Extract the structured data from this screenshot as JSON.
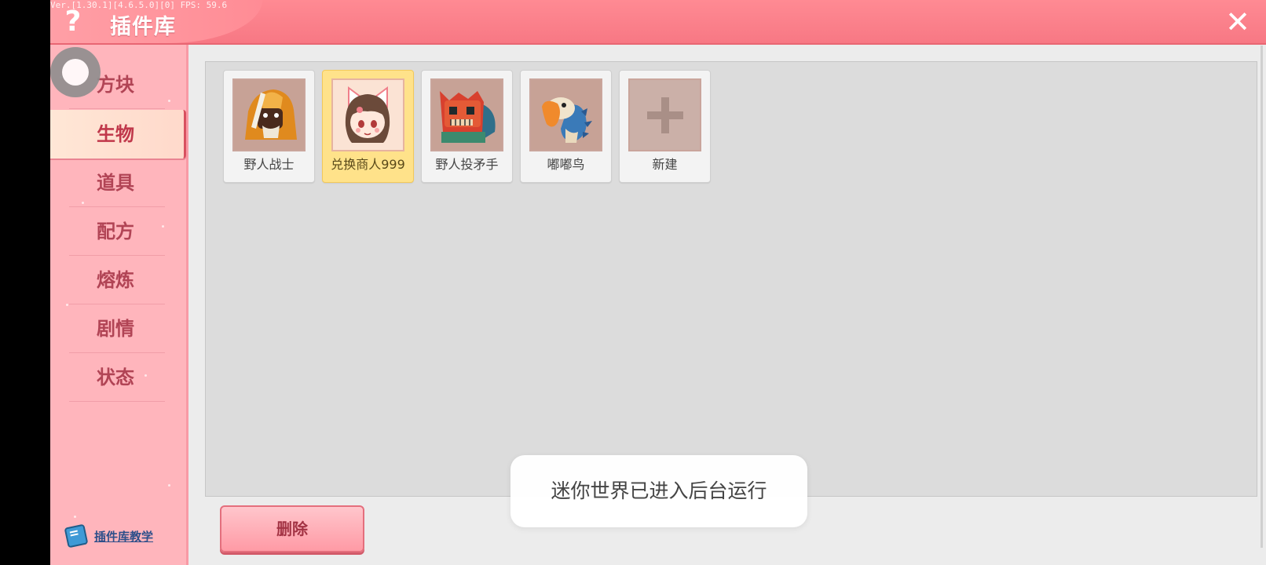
{
  "debug_text": "Ver.[1.30.1][4.6.5.0][0] FPS: 59.6",
  "titlebar": {
    "help_glyph": "?",
    "title": "插件库",
    "close_glyph": "✕"
  },
  "sidebar": {
    "items": [
      {
        "label": "方块",
        "active": false
      },
      {
        "label": "生物",
        "active": true
      },
      {
        "label": "道具",
        "active": false
      },
      {
        "label": "配方",
        "active": false
      },
      {
        "label": "熔炼",
        "active": false
      },
      {
        "label": "剧情",
        "active": false
      },
      {
        "label": "状态",
        "active": false
      }
    ],
    "tutorial_label": "插件库教学"
  },
  "plugins": [
    {
      "name": "野人战士",
      "icon": "savage-warrior-icon",
      "selected": false
    },
    {
      "name": "兑换商人999",
      "icon": "merchant-girl-icon",
      "selected": true
    },
    {
      "name": "野人投矛手",
      "icon": "savage-spearman-icon",
      "selected": false
    },
    {
      "name": "嘟嘟鸟",
      "icon": "dodo-bird-icon",
      "selected": false
    },
    {
      "name": "新建",
      "icon": "plus-icon",
      "selected": false
    }
  ],
  "delete_label": "删除",
  "toast": "迷你世界已进入后台运行",
  "colors": {
    "titlebar": "#f77884",
    "sidebar": "#ffb5bc",
    "selected_card": "#ffe28a",
    "panel": "#dcdcdc"
  }
}
